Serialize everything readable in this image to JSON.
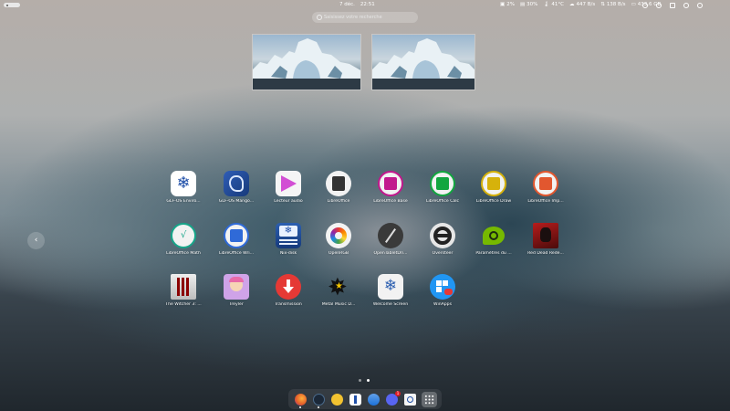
{
  "topbar": {
    "date": "7 déc.",
    "time": "22:51",
    "status": [
      {
        "icon": "cpu-icon",
        "value": "2%"
      },
      {
        "icon": "memory-icon",
        "value": "30%"
      },
      {
        "icon": "temperature-icon",
        "value": "41°C"
      },
      {
        "icon": "download-icon",
        "value": "447 B/s"
      },
      {
        "icon": "upload-icon",
        "value": "138 B/s"
      },
      {
        "icon": "disk-icon",
        "value": "433.6 GB"
      }
    ]
  },
  "search": {
    "placeholder": "Saisissez votre recherche"
  },
  "apps": [
    {
      "label": "GLF-OS Enviro..."
    },
    {
      "label": "GLF-OS Mango..."
    },
    {
      "label": "Lecteur audio"
    },
    {
      "label": "LibreOffice"
    },
    {
      "label": "LibreOffice Base"
    },
    {
      "label": "LibreOffice Calc"
    },
    {
      "label": "LibreOffice Draw"
    },
    {
      "label": "LibreOffice Imp..."
    },
    {
      "label": "LibreOffice Math"
    },
    {
      "label": "LibreOffice Wri..."
    },
    {
      "label": "Nix-disk"
    },
    {
      "label": "OpenRGB"
    },
    {
      "label": "OpenTabletDri..."
    },
    {
      "label": "Oversteer"
    },
    {
      "label": "Paramètres du ..."
    },
    {
      "label": "Red Dead Rede..."
    },
    {
      "label": "The Witcher 3: ..."
    },
    {
      "label": "Treyler"
    },
    {
      "label": "Transmission"
    },
    {
      "label": "Metal Music D..."
    },
    {
      "label": "Welcome Screen"
    },
    {
      "label": "WinApps"
    }
  ],
  "dock_badge": "1",
  "colors": {
    "base": "#7324a9",
    "calc": "#12a63f",
    "draw": "#d6b20b",
    "impress": "#e2572f",
    "math": "#17a589",
    "writer": "#2f6ad8",
    "transmission": "#e53935",
    "nvidia": "#76b900"
  }
}
